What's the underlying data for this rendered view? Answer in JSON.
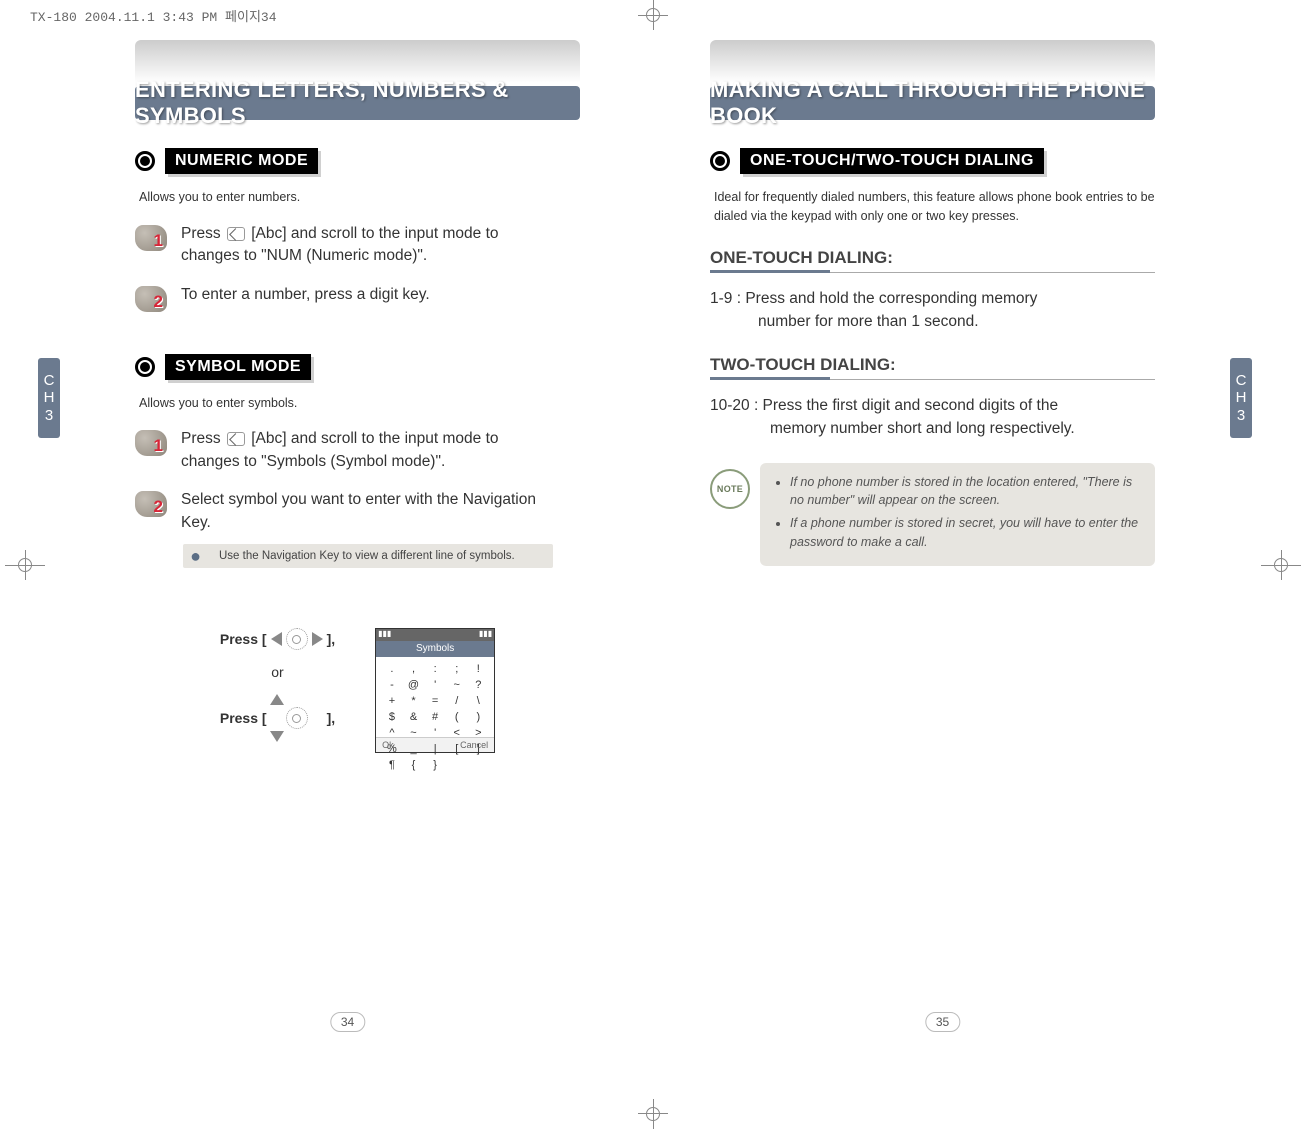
{
  "file_header": "TX-180  2004.11.1 3:43 PM  페이지34",
  "side_tab": {
    "line1": "C",
    "line2": "H",
    "line3": "3"
  },
  "left": {
    "title": "ENTERING LETTERS, NUMBERS & SYMBOLS",
    "numeric": {
      "label": "NUMERIC MODE",
      "intro": "Allows you to enter numbers.",
      "step1": "Press        [Abc] and scroll to the input mode to changes to \"NUM (Numeric mode)\".",
      "step2": "To enter a number, press a digit key."
    },
    "symbol": {
      "label": "SYMBOL MODE",
      "intro": "Allows you to enter symbols.",
      "step1": "Press        [Abc] and scroll to the input mode to changes to \"Symbols (Symbol mode)\".",
      "step2": "Select symbol you want to enter with the Navigation Key.",
      "tip": "Use the Navigation Key to view a different line of symbols."
    },
    "figure": {
      "press_a_prefix": "Press [",
      "press_a_suffix": "],",
      "or": "or",
      "press_b_prefix": "Press [",
      "press_b_suffix": "],"
    },
    "phone": {
      "title": "Symbols",
      "symbols": [
        ".",
        ",",
        ":",
        ";",
        "!",
        "-",
        "@",
        "'",
        "~",
        "?",
        "+",
        "*",
        "=",
        "/",
        "\\",
        "$",
        "&",
        "#",
        "(",
        ")",
        "^",
        "~",
        "'",
        "<",
        ">",
        "%",
        "_",
        "|",
        "[",
        "]",
        "¶",
        "{",
        "}",
        " ",
        " "
      ],
      "soft_left": "Ok",
      "soft_right": "Cancel"
    },
    "page_number": "34"
  },
  "right": {
    "title": "MAKING A CALL THROUGH THE PHONE BOOK",
    "section_label": "ONE-TOUCH/TWO-TOUCH DIALING",
    "intro": "Ideal for frequently dialed numbers, this feature allows phone book entries to be dialed via the keypad with only one or two key presses.",
    "sub1": "ONE-TOUCH DIALING:",
    "body1a": "1-9 : Press and hold the corresponding memory",
    "body1b": "number for more than 1 second.",
    "sub2": "TWO-TOUCH DIALING:",
    "body2a": "10-20 : Press the first digit and second digits of the",
    "body2b": "memory number short and long respectively.",
    "note1": "If no phone number is stored in the location entered, \"There is no number\" will appear on the screen.",
    "note2": "If a phone number is stored in secret, you will have to enter the password to make a call.",
    "note_icon_label": "NOTE",
    "page_number": "35"
  }
}
